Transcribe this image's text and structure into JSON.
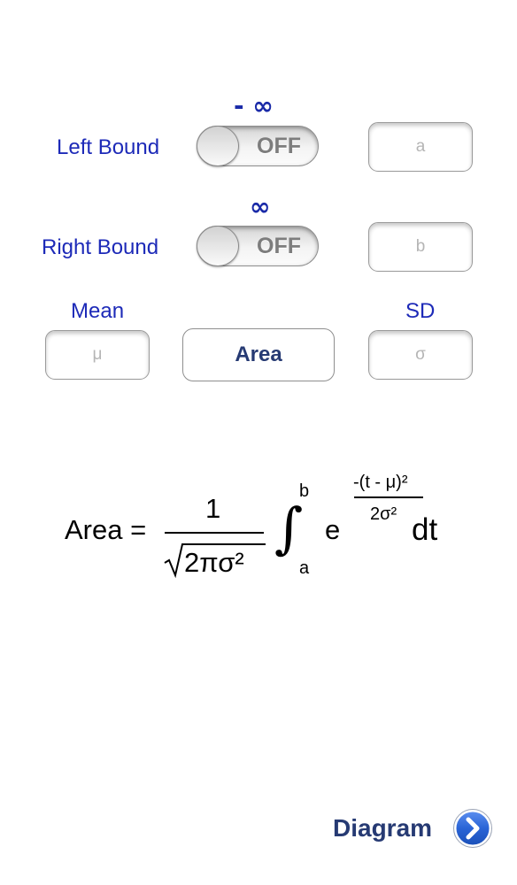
{
  "left_bound": {
    "infinity_symbol": "- ∞",
    "label": "Left Bound",
    "toggle_state": "OFF",
    "field_placeholder": "a"
  },
  "right_bound": {
    "infinity_symbol": "∞",
    "label": "Right Bound",
    "toggle_state": "OFF",
    "field_placeholder": "b"
  },
  "mean": {
    "label": "Mean",
    "field_placeholder": "μ"
  },
  "sd": {
    "label": "SD",
    "field_placeholder": "σ"
  },
  "area_button_label": "Area",
  "formula": {
    "lhs": "Area =",
    "numerator": "1",
    "radical": "√",
    "radicand": "2πσ²",
    "integral": "∫",
    "upper_limit": "b",
    "lower_limit": "a",
    "base": "e",
    "exp_numerator": "-(t - μ)²",
    "exp_denominator": "2σ²",
    "differential": "dt"
  },
  "diagram_link": {
    "label": "Diagram",
    "icon": "chevron-right-circle-icon",
    "icon_color": "#2a64d6"
  },
  "colors": {
    "label_blue": "#1d2ab8",
    "button_text": "#263a73"
  }
}
